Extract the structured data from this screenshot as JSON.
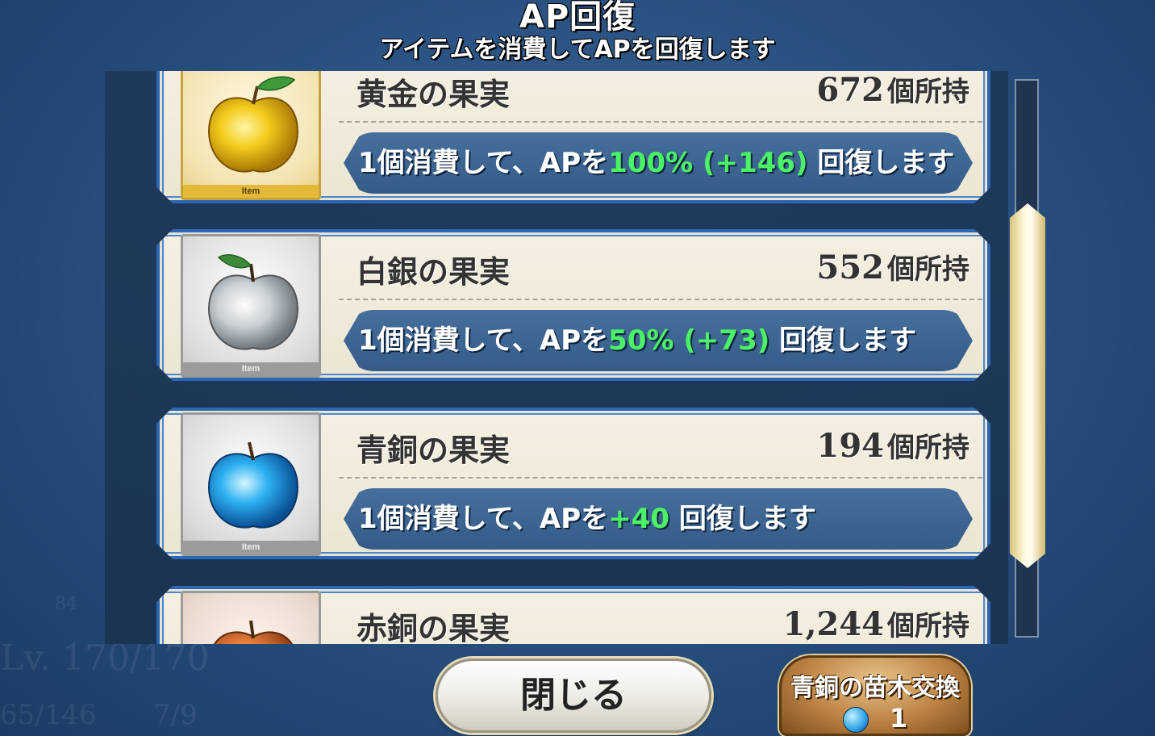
{
  "header": {
    "title": "AP回復",
    "subtitle": "アイテムを消費してAPを回復します"
  },
  "background": {
    "level_text": "Lv. 170/170",
    "ap_text": "65/146",
    "ratio_text": "7/9",
    "small_number": "84"
  },
  "items": [
    {
      "name": "黄金の果実",
      "count": "672",
      "count_unit": "個所持",
      "tag": "Item",
      "effect_prefix": "1個消費して、APを",
      "effect_value": "100% (+146)",
      "effect_suffix": " 回復します",
      "icon": "golden-apple-icon",
      "color": "#f2c11a"
    },
    {
      "name": "白銀の果実",
      "count": "552",
      "count_unit": "個所持",
      "tag": "Item",
      "effect_prefix": "1個消費して、APを",
      "effect_value": "50% (+73)",
      "effect_suffix": " 回復します",
      "icon": "silver-apple-icon",
      "color": "#d6dde2"
    },
    {
      "name": "青銅の果実",
      "count": "194",
      "count_unit": "個所持",
      "tag": "Item",
      "effect_prefix": "1個消費して、APを",
      "effect_value": "+40",
      "effect_suffix": " 回復します",
      "icon": "bronze-apple-icon",
      "color": "#2aa8ee"
    },
    {
      "name": "赤銅の果実",
      "count": "1,244",
      "count_unit": "個所持",
      "icon": "copper-apple-icon",
      "color": "#e07a3c"
    }
  ],
  "buttons": {
    "close": "閉じる",
    "exchange": "青銅の苗木交換",
    "exchange_cost": "1",
    "exchange_icon": "bronze-seed-icon"
  },
  "colors": {
    "highlight": "#4cf266",
    "card_border": "#2c67b3",
    "effect_bar": "#3f6894"
  }
}
